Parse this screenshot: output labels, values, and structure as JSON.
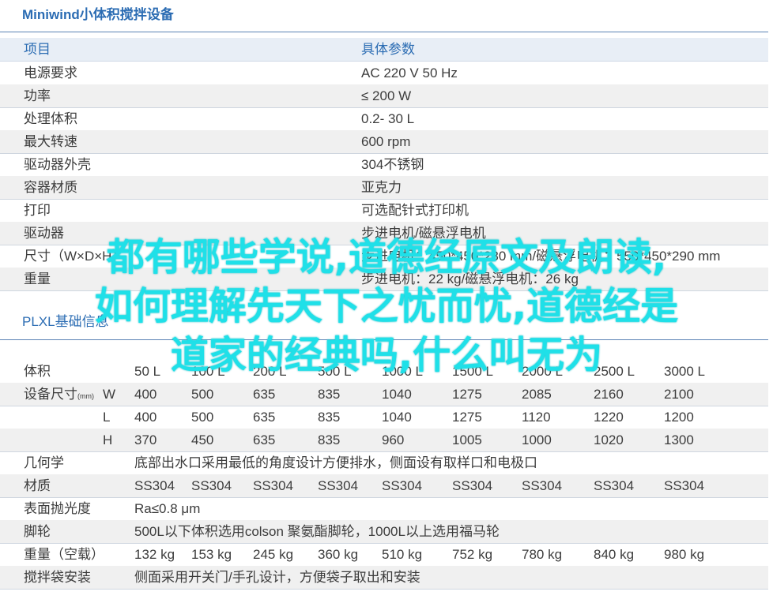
{
  "title": "Miniwind小体积搅拌设备",
  "spec_table": {
    "header": {
      "item": "项目",
      "value": "具体参数"
    },
    "rows": [
      {
        "key": "电源要求",
        "value": "AC 220  V 50 Hz"
      },
      {
        "key": "功率",
        "value": "≤ 200 W"
      },
      {
        "key": "处理体积",
        "value": "0.2- 30 L"
      },
      {
        "key": "最大转速",
        "value": "600  rpm"
      },
      {
        "key": "驱动器外壳",
        "value": "304不锈钢"
      },
      {
        "key": "容器材质",
        "value": "亚克力"
      },
      {
        "key": "打印",
        "value": "可选配针式打印机"
      },
      {
        "key": "驱动器",
        "value": "步进电机/磁悬浮电机"
      },
      {
        "key": "尺寸（W×D×H）",
        "value": "步进电机：450*450*280 mm/磁悬浮电机：550*450*290 mm"
      },
      {
        "key": "重量",
        "value": "步进电机：22 kg/磁悬浮电机：26 kg"
      }
    ]
  },
  "section_title": "PLXL基础信息",
  "plxl_table": {
    "volume": {
      "label": "体积",
      "values": [
        "50 L",
        "100 L",
        "200 L",
        "500 L",
        "1000 L",
        "1500 L",
        "2000 L",
        "2500 L",
        "3000 L"
      ]
    },
    "size": {
      "label": "设备尺寸",
      "unit": "(mm)",
      "W": {
        "axis": "W",
        "values": [
          "400",
          "500",
          "635",
          "835",
          "1040",
          "1275",
          "2085",
          "2160",
          "2100"
        ]
      },
      "L": {
        "axis": "L",
        "values": [
          "400",
          "500",
          "635",
          "835",
          "1040",
          "1275",
          "1120",
          "1220",
          "1200"
        ]
      },
      "H": {
        "axis": "H",
        "values": [
          "370",
          "450",
          "635",
          "835",
          "960",
          "1005",
          "1000",
          "1020",
          "1300"
        ]
      }
    },
    "geometry": {
      "label": "几何学",
      "value": "底部出水口采用最低的角度设计方便排水，侧面设有取样口和电极口"
    },
    "material": {
      "label": "材质",
      "values": [
        "SS304",
        "SS304",
        "SS304",
        "SS304",
        "SS304",
        "SS304",
        "SS304",
        "SS304",
        "SS304"
      ]
    },
    "polish": {
      "label": "表面抛光度",
      "value": "Ra≤0.8 μm"
    },
    "casters": {
      "label": "脚轮",
      "value": "500L以下体积选用colson 聚氨酯脚轮，1000L以上选用福马轮"
    },
    "weight": {
      "label": "重量（空载）",
      "values": [
        "132 kg",
        "153 kg",
        "245 kg",
        "360 kg",
        "510 kg",
        "752 kg",
        "780 kg",
        "840 kg",
        "980 kg"
      ]
    },
    "bag": {
      "label": "搅拌袋安装",
      "value": "侧面采用开关门/手孔设计，方便袋子取出和安装"
    }
  },
  "overlay_text": [
    "都有哪些学说,道德经原文及朗读,",
    "如何理解先天下之忧而忧,道德经是",
    "道家的经典吗,什么叫无为"
  ]
}
